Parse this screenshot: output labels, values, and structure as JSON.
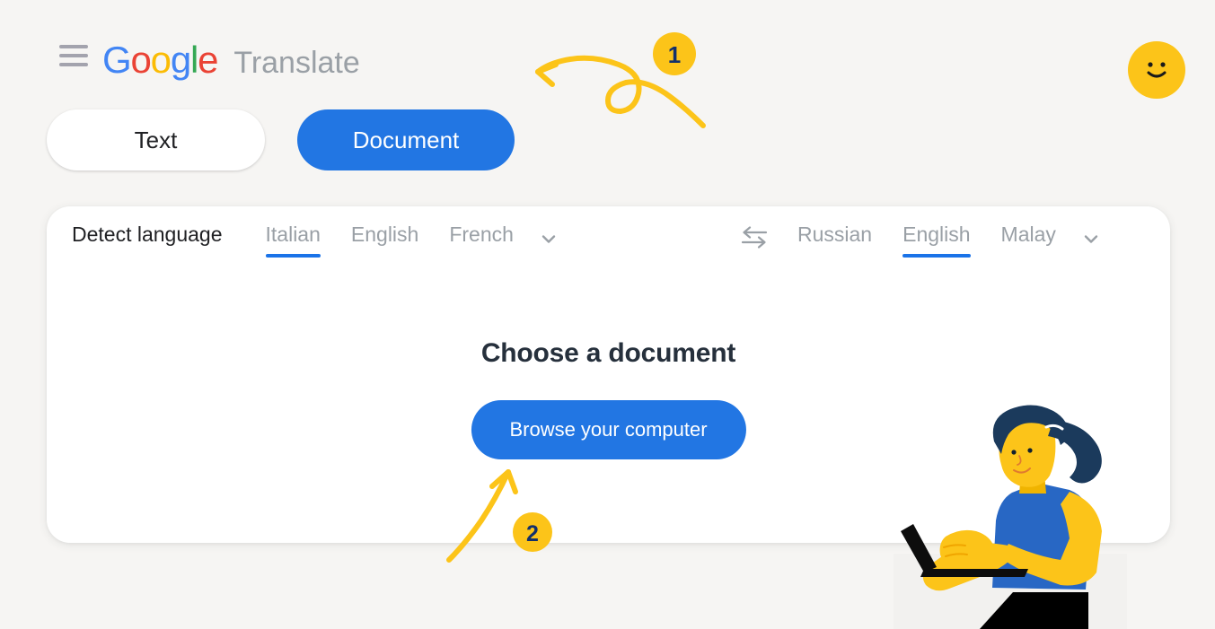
{
  "app": {
    "brand_google": "Google",
    "brand_google_letters": [
      "G",
      "o",
      "o",
      "g",
      "l",
      "e"
    ],
    "brand_product": "Translate",
    "menu_icon": "hamburger-menu-icon",
    "avatar_icon": "smiley-face-avatar-icon"
  },
  "mode_tabs": [
    {
      "label": "Text",
      "active": false
    },
    {
      "label": "Document",
      "active": true
    }
  ],
  "source_languages": {
    "detect_label": "Detect language",
    "options": [
      {
        "label": "Italian",
        "selected": true
      },
      {
        "label": "English",
        "selected": false
      },
      {
        "label": "French",
        "selected": false
      }
    ],
    "more_icon": "chevron-down-icon"
  },
  "swap": {
    "icon": "swap-languages-icon"
  },
  "target_languages": {
    "options": [
      {
        "label": "Russian",
        "selected": false
      },
      {
        "label": "English",
        "selected": true
      },
      {
        "label": "Malay",
        "selected": false
      }
    ],
    "more_icon": "chevron-down-icon"
  },
  "document_panel": {
    "title": "Choose a document",
    "browse_button": "Browse your computer"
  },
  "annotations": [
    {
      "id": "1",
      "label": "1",
      "shape": "curly-arrow-pointing-left"
    },
    {
      "id": "2",
      "label": "2",
      "shape": "curved-arrow-pointing-up"
    }
  ],
  "illustration": {
    "name": "woman-with-laptop-illustration"
  },
  "colors": {
    "page_background": "#f6f5f3",
    "card_background": "#ffffff",
    "accent_blue": "#2276e3",
    "underline_blue": "#1a73e8",
    "annotation_yellow": "#fcc419",
    "annotation_number": "#12306b",
    "muted_text": "#9aa0a6",
    "primary_text": "#202124",
    "title_text": "#26303c",
    "google_blue": "#4285f4",
    "google_red": "#ea4335",
    "google_yellow": "#fbbc05",
    "google_green": "#34a853",
    "illustration_hair": "#1b3a5c",
    "illustration_skin": "#fcc419",
    "illustration_shirt": "#2867c4",
    "illustration_pants": "#000000"
  }
}
